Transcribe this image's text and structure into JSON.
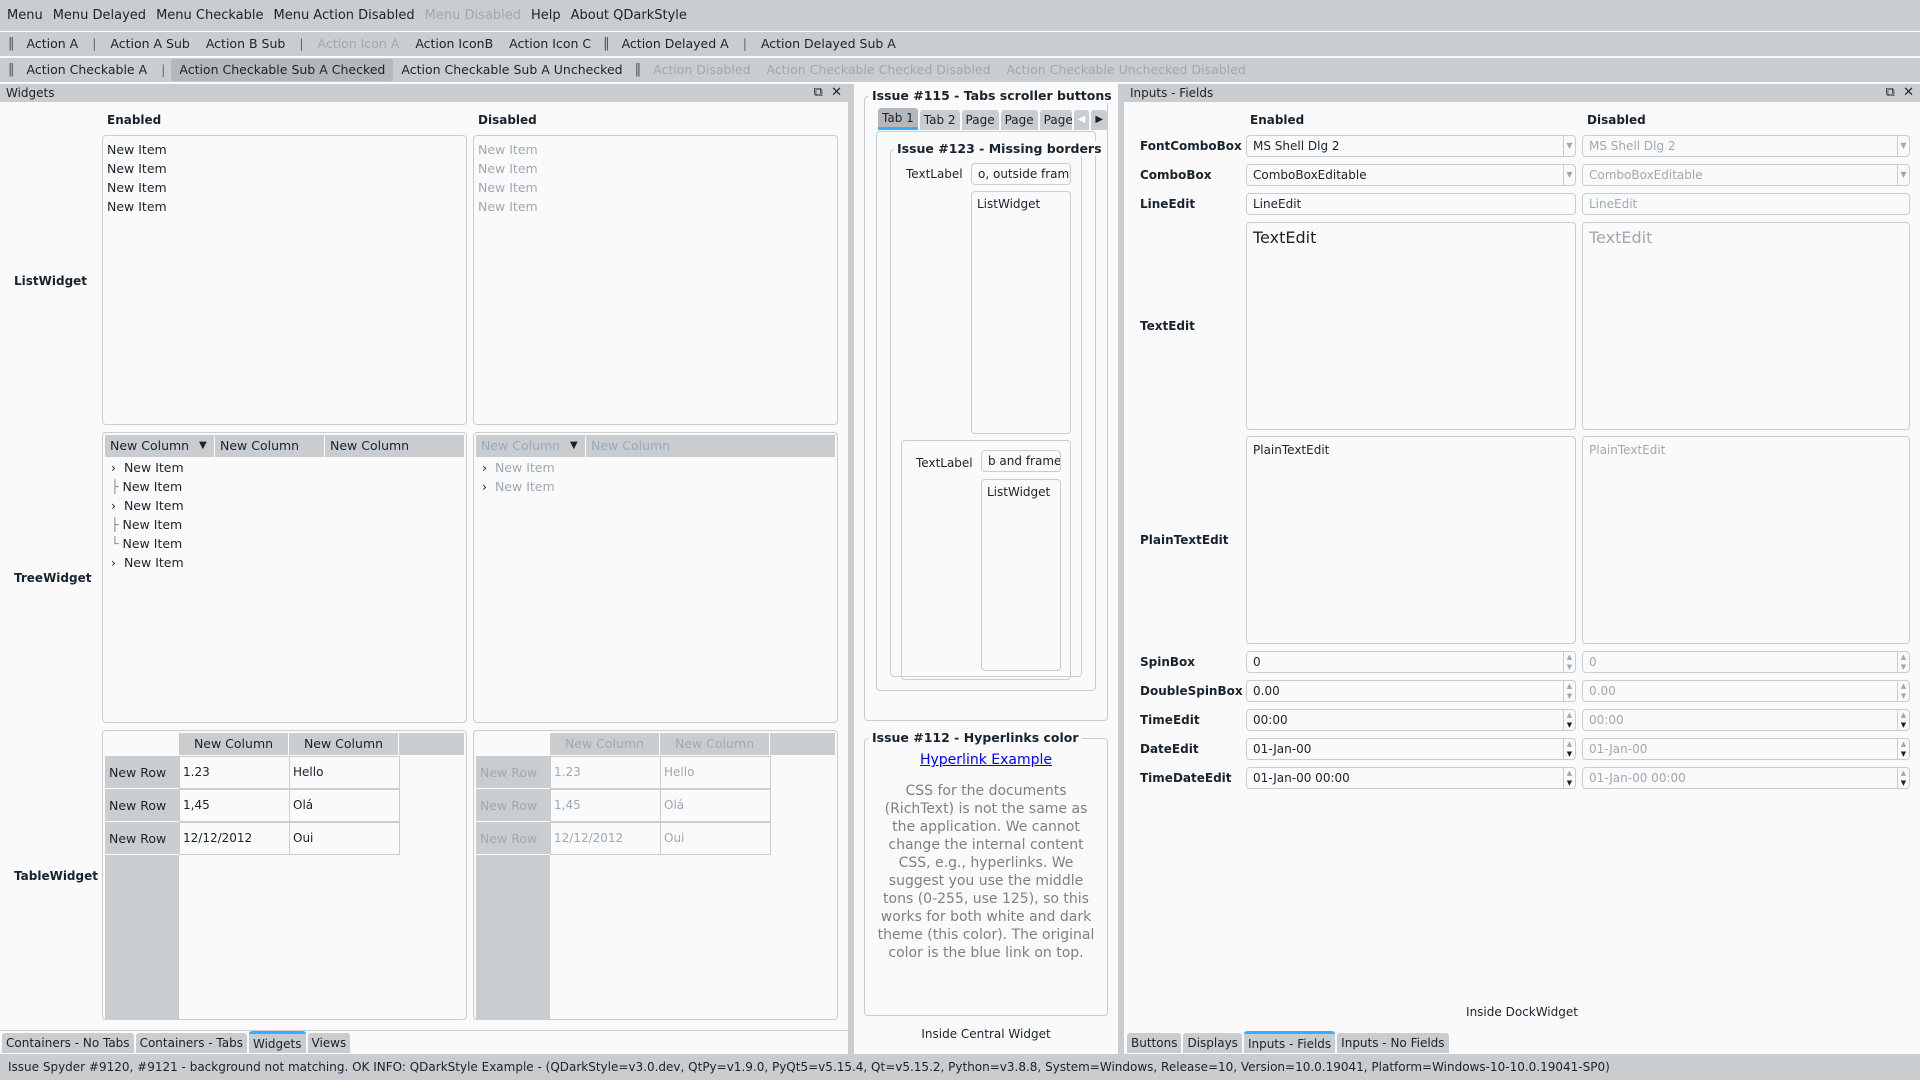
{
  "menubar": [
    "Menu",
    "Menu Delayed",
    "Menu Checkable",
    "Menu Action Disabled",
    "Menu Disabled",
    "Help",
    "About QDarkStyle"
  ],
  "menubar_disabled": [
    false,
    false,
    false,
    false,
    true,
    false,
    false
  ],
  "toolbar1": {
    "action_a": "Action A",
    "action_a_sub": "Action A Sub",
    "action_b_sub": "Action B Sub",
    "action_icon_a": "Action Icon A",
    "action_iconb": "Action IconB",
    "action_icon_c": "Action Icon C",
    "action_delayed_a": "Action Delayed A",
    "action_delayed_sub_a": "Action Delayed Sub A"
  },
  "toolbar2": {
    "checkable_a": "Action Checkable A",
    "checkable_sub_checked": "Action Checkable Sub A Checked",
    "checkable_sub_unchecked": "Action Checkable Sub A Unchecked",
    "disabled": "Action Disabled",
    "checked_disabled": "Action Checkable Checked Disabled",
    "unchecked_disabled": "Action Checkable Unchecked Disabled"
  },
  "widgets_dock": {
    "title": "Widgets",
    "enabled": "Enabled",
    "disabled": "Disabled",
    "row_labels": {
      "list": "ListWidget",
      "tree": "TreeWidget",
      "table": "TableWidget"
    },
    "list_items": [
      "New Item",
      "New Item",
      "New Item",
      "New Item"
    ],
    "tree_columns_enabled": [
      "New Column",
      "New Column",
      "New Column"
    ],
    "tree_columns_disabled": [
      "New Column",
      "New Column"
    ],
    "tree_items_enabled": [
      "New Item",
      "New Item",
      "New Item",
      "New Item",
      "New Item",
      "New Item"
    ],
    "tree_items_disabled": [
      "New Item",
      "New Item"
    ],
    "table_columns": [
      "New Column",
      "New Column"
    ],
    "table_rows": [
      {
        "header": "New Row",
        "cells": [
          "1.23",
          "Hello"
        ]
      },
      {
        "header": "New Row",
        "cells": [
          "1,45",
          "Olá"
        ]
      },
      {
        "header": "New Row",
        "cells": [
          "12/12/2012",
          "Oui"
        ]
      }
    ],
    "bottom_tabs": [
      "Containers - No Tabs",
      "Containers - Tabs",
      "Widgets",
      "Views"
    ],
    "selected_tab": "Widgets"
  },
  "central": {
    "issue115": "Issue #115 - Tabs scroller buttons",
    "tabs": [
      "Tab 1",
      "Tab 2",
      "Page",
      "Page",
      "Page"
    ],
    "issue123": "Issue #123 - Missing borders",
    "textlabel": "TextLabel",
    "lineedit1": "o, outside frame",
    "listwidget": "ListWidget",
    "lineedit2": "b and frame",
    "issue112": "Issue #112 - Hyperlinks color",
    "hyperlink": "Hyperlink Example",
    "paragraph": "CSS for the documents (RichText) is not the same as the application. We cannot change the internal content CSS, e.g., hyperlinks. We suggest you use the middle tons (0-255, use 125), so this works for both white and dark theme (this color). The original color is the blue link on top.",
    "footer": "Inside Central Widget",
    "link_color": "#0000FF"
  },
  "inputs_dock": {
    "title": "Inputs - Fields",
    "enabled": "Enabled",
    "disabled": "Disabled",
    "labels": {
      "font": "FontComboBox",
      "combo": "ComboBox",
      "line": "LineEdit",
      "text": "TextEdit",
      "plain": "PlainTextEdit",
      "spin": "SpinBox",
      "dspin": "DoubleSpinBox",
      "time": "TimeEdit",
      "date": "DateEdit",
      "datetime": "TimeDateEdit"
    },
    "values": {
      "font": "MS Shell Dlg 2",
      "combo": "ComboBoxEditable",
      "line": "LineEdit",
      "text": "TextEdit",
      "plain": "PlainTextEdit",
      "spin": "0",
      "dspin": "0.00",
      "time": "00:00",
      "date": "01-Jan-00",
      "datetime": "01-Jan-00 00:00"
    },
    "footer": "Inside DockWidget",
    "bottom_tabs": [
      "Buttons",
      "Displays",
      "Inputs - Fields",
      "Inputs - No Fields"
    ],
    "selected_tab": "Inputs - Fields"
  },
  "status": "Issue Spyder #9120, #9121 - background not matching.    OK    INFO: QDarkStyle Example - (QDarkStyle=v3.0.dev, QtPy=v1.9.0, PyQt5=v5.15.4, Qt=v5.15.2, Python=v3.8.8, System=Windows, Release=10, Version=10.0.19041, Platform=Windows-10-10.0.19041-SP0)",
  "colors": {
    "accent": "#37AEFE",
    "bar": "#C9CDD0",
    "bg": "#FAFAFA",
    "disabled_text": "#9DA9B5"
  }
}
